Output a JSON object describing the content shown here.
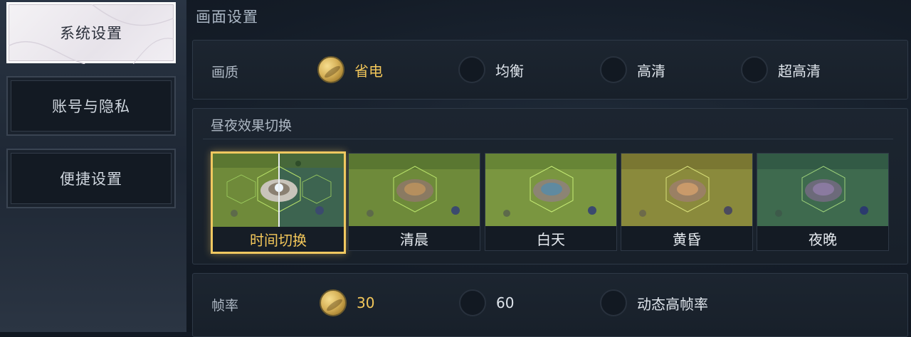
{
  "sidebar": {
    "items": [
      {
        "label": "系统设置",
        "active": true
      },
      {
        "label": "账号与隐私",
        "active": false
      },
      {
        "label": "便捷设置",
        "active": false
      }
    ]
  },
  "main": {
    "section_title": "画面设置",
    "quality": {
      "label": "画质",
      "options": [
        "省电",
        "均衡",
        "高清",
        "超高清"
      ],
      "selected": "省电"
    },
    "daynight": {
      "title": "昼夜效果切换",
      "options": [
        "时间切换",
        "清晨",
        "白天",
        "黄昏",
        "夜晚"
      ],
      "selected": "时间切换"
    },
    "fps": {
      "label": "帧率",
      "options": [
        "30",
        "60",
        "动态高帧率"
      ],
      "selected": "30"
    }
  },
  "colors": {
    "accent_gold": "#f3c75a",
    "panel_bg": "#18202a",
    "sidebar_active_bg": "#f1eef3"
  }
}
